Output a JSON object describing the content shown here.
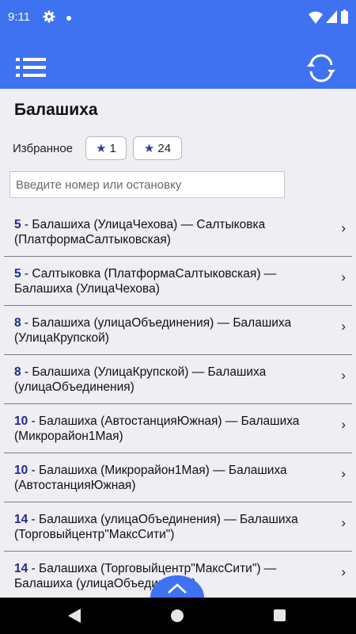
{
  "status": {
    "time": "9:11"
  },
  "header": {
    "city": "Балашиха"
  },
  "favorites": {
    "label": "Избранное",
    "chips": [
      {
        "star": "★",
        "count": "1"
      },
      {
        "star": "★",
        "count": "24"
      }
    ]
  },
  "search": {
    "placeholder": "Введите номер или остановку",
    "value": ""
  },
  "routes": [
    {
      "number": "5",
      "text": " - Балашиха (УлицаЧехова) — Салтыковка (ПлатформаСалтыковская)"
    },
    {
      "number": "5",
      "text": " - Салтыковка (ПлатформаСалтыковская) — Балашиха (УлицаЧехова)"
    },
    {
      "number": "8",
      "text": " - Балашиха (улицаОбъединения) — Балашиха (УлицаКрупской)"
    },
    {
      "number": "8",
      "text": " - Балашиха (УлицаКрупской) — Балашиха (улицаОбъединения)"
    },
    {
      "number": "10",
      "text": " - Балашиха (АвтостанцияЮжная) — Балашиха (Микрорайон1Мая)"
    },
    {
      "number": "10",
      "text": " - Балашиха (Микрорайон1Мая) — Балашиха (АвтостанцияЮжная)"
    },
    {
      "number": "14",
      "text": " - Балашиха (улицаОбъединения) — Балашиха (Торговыйцентр\"МаксСити\")"
    },
    {
      "number": "14",
      "text": " - Балашиха (Торговыйцентр\"МаксСити\") — Балашиха (улицаОбъединения)"
    }
  ],
  "route_chevron": "›",
  "colors": {
    "primary": "#3e72f1",
    "route_number": "#1f2a8a",
    "background": "#eeeef3"
  },
  "icons": {
    "menu": "list-menu-icon",
    "refresh": "refresh-icon",
    "fab": "chevron-up-icon",
    "nav_back": "triangle-back-icon",
    "nav_home": "circle-home-icon",
    "nav_recent": "square-recents-icon"
  }
}
